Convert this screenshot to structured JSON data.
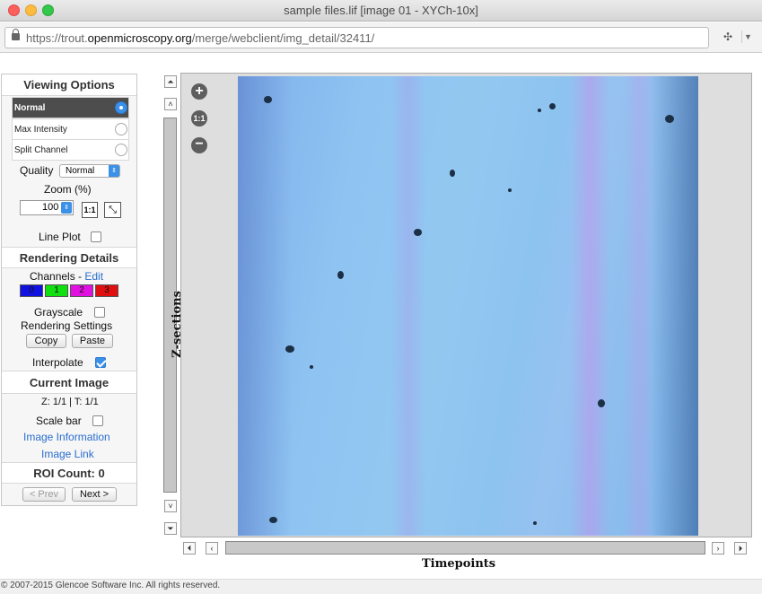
{
  "window": {
    "title": "sample files.lif [image 01 - XYCh-10x]",
    "url_prefix": "https://trout.",
    "url_domain": "openmicroscopy.org",
    "url_path": "/merge/webclient/img_detail/32411/"
  },
  "left_panel": {
    "viewing_options_title": "Viewing Options",
    "modes": [
      {
        "label": "Normal",
        "selected": true
      },
      {
        "label": "Max Intensity",
        "selected": false
      },
      {
        "label": "Split Channel",
        "selected": false
      }
    ],
    "quality_label": "Quality",
    "quality_value": "Normal",
    "zoom_label": "Zoom (%)",
    "zoom_value": "100",
    "zoom_fit_label": "1:1",
    "line_plot_label": "Line Plot",
    "line_plot_checked": false,
    "rendering_details_title": "Rendering Details",
    "channels_label": "Channels -",
    "channels_edit": "Edit",
    "channels": [
      {
        "label": "0",
        "color": "#1010e0"
      },
      {
        "label": "1",
        "color": "#10e010"
      },
      {
        "label": "2",
        "color": "#e010e0"
      },
      {
        "label": "3",
        "color": "#e01010"
      }
    ],
    "grayscale_label": "Grayscale",
    "grayscale_checked": false,
    "rendering_settings_label": "Rendering Settings",
    "copy_label": "Copy",
    "paste_label": "Paste",
    "interpolate_label": "Interpolate",
    "interpolate_checked": true,
    "current_image_title": "Current Image",
    "z_t_text": "Z: 1/1 | T: 1/1",
    "scale_bar_label": "Scale bar",
    "scale_bar_checked": false,
    "image_information_link": "Image Information",
    "image_link": "Image Link",
    "roi_count": "ROI Count: 0",
    "prev_label": "< Prev",
    "next_label": "Next >"
  },
  "viewer": {
    "z_sections_label": "Z-sections",
    "timepoints_label": "Timepoints",
    "zoom_in_icon": "plus-icon",
    "zoom_reset_label": "1:1",
    "zoom_out_icon": "minus-icon"
  },
  "footer": {
    "copyright": "© 2007-2015 Glencoe Software Inc. All rights reserved."
  },
  "colors": {
    "accent": "#3b90e8",
    "link": "#2a6ecf"
  }
}
